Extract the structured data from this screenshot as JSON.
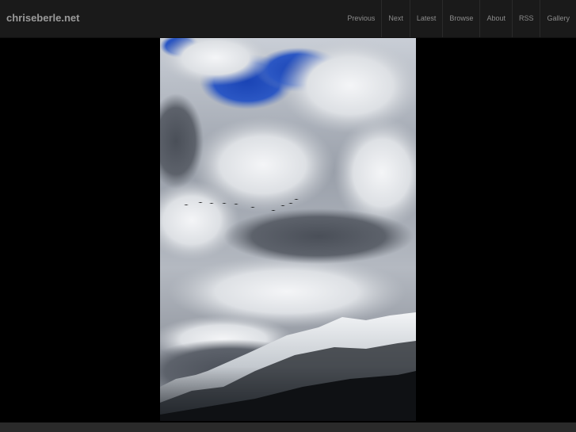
{
  "site": {
    "title": "chriseberle.net"
  },
  "nav": {
    "items": [
      "Previous",
      "Next",
      "Latest",
      "Browse",
      "About",
      "RSS",
      "Gallery"
    ]
  },
  "photo": {
    "subject": "photo"
  }
}
